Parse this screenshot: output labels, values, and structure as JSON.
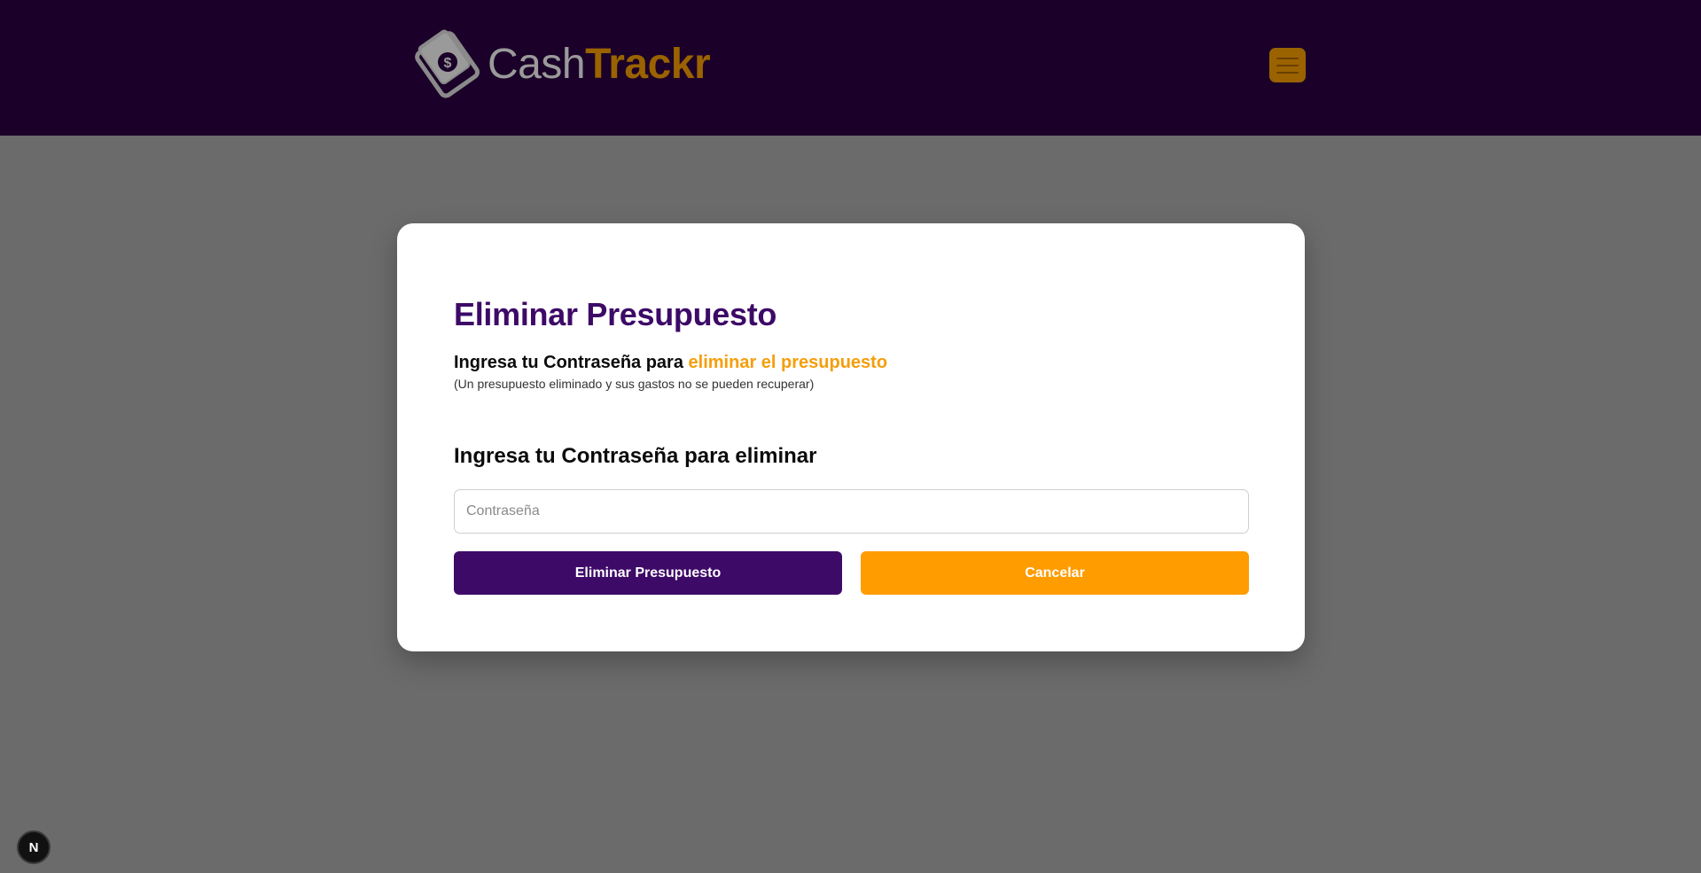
{
  "header": {
    "logo_cash": "Cash",
    "logo_trackr": "Trackr",
    "logo_icon": "money-wallet-icon",
    "menu_icon": "hamburger-menu-icon"
  },
  "modal": {
    "title": "Eliminar Presupuesto",
    "subtitle_prefix": "Ingresa tu Contraseña para ",
    "subtitle_highlight": "eliminar el presupuesto",
    "note": "(Un presupuesto eliminado y sus gastos no se pueden recuperar)",
    "field_label": "Ingresa tu Contraseña para eliminar",
    "password_placeholder": "Contraseña",
    "password_value": "",
    "delete_button": "Eliminar Presupuesto",
    "cancel_button": "Cancelar"
  },
  "dev_indicator": {
    "label": "N"
  },
  "colors": {
    "header_bg": "#1b0129",
    "primary": "#3d0a67",
    "accent": "#ff9c00",
    "highlight": "#f59e0b"
  }
}
